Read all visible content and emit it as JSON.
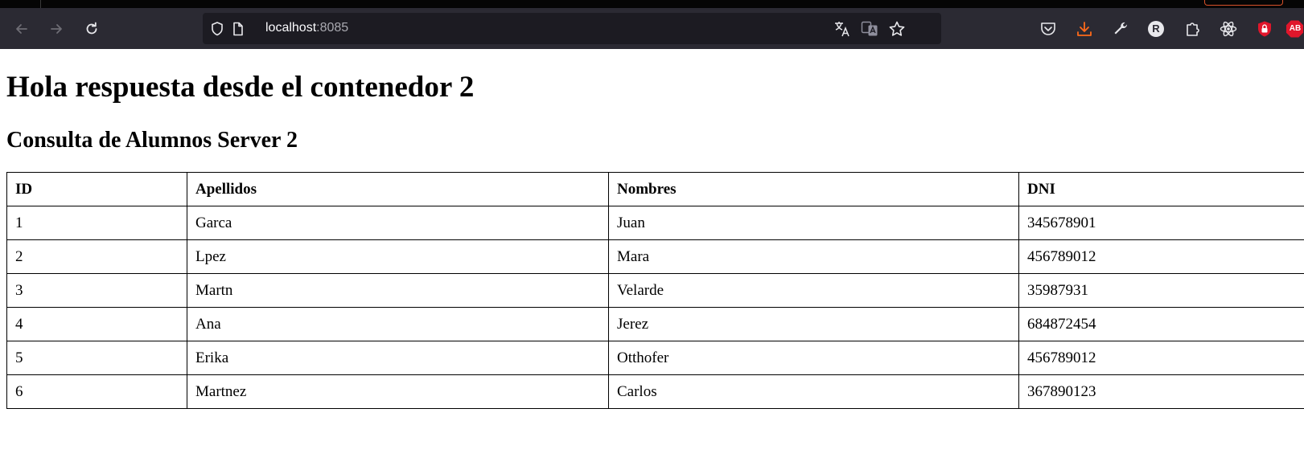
{
  "browser": {
    "url_host": "localhost",
    "url_port": ":8085",
    "toolbar_icons": [
      "back-icon",
      "forward-icon",
      "reload-icon",
      "shield-icon",
      "page-icon",
      "translate-icon",
      "translate-page-icon",
      "bookmark-star-icon",
      "pocket-icon",
      "download-icon",
      "wrench-icon",
      "extension-r-icon",
      "extensions-icon",
      "react-devtools-icon",
      "lock-shield-icon",
      "adblock-icon"
    ],
    "accent_color": "#ff6a1a",
    "adblock_label": "AB",
    "extension_r_label": "R"
  },
  "page": {
    "heading": "Hola respuesta desde el contenedor 2",
    "subheading": "Consulta de Alumnos Server 2"
  },
  "table": {
    "headers": [
      "ID",
      "Apellidos",
      "Nombres",
      "DNI"
    ],
    "rows": [
      [
        "1",
        "Garca",
        "Juan",
        "345678901"
      ],
      [
        "2",
        "Lpez",
        "Mara",
        "456789012"
      ],
      [
        "3",
        "Martn",
        "Velarde",
        "35987931"
      ],
      [
        "4",
        "Ana",
        "Jerez",
        "684872454"
      ],
      [
        "5",
        "Erika",
        "Otthofer",
        "456789012"
      ],
      [
        "6",
        "Martnez",
        "Carlos",
        "367890123"
      ]
    ]
  }
}
